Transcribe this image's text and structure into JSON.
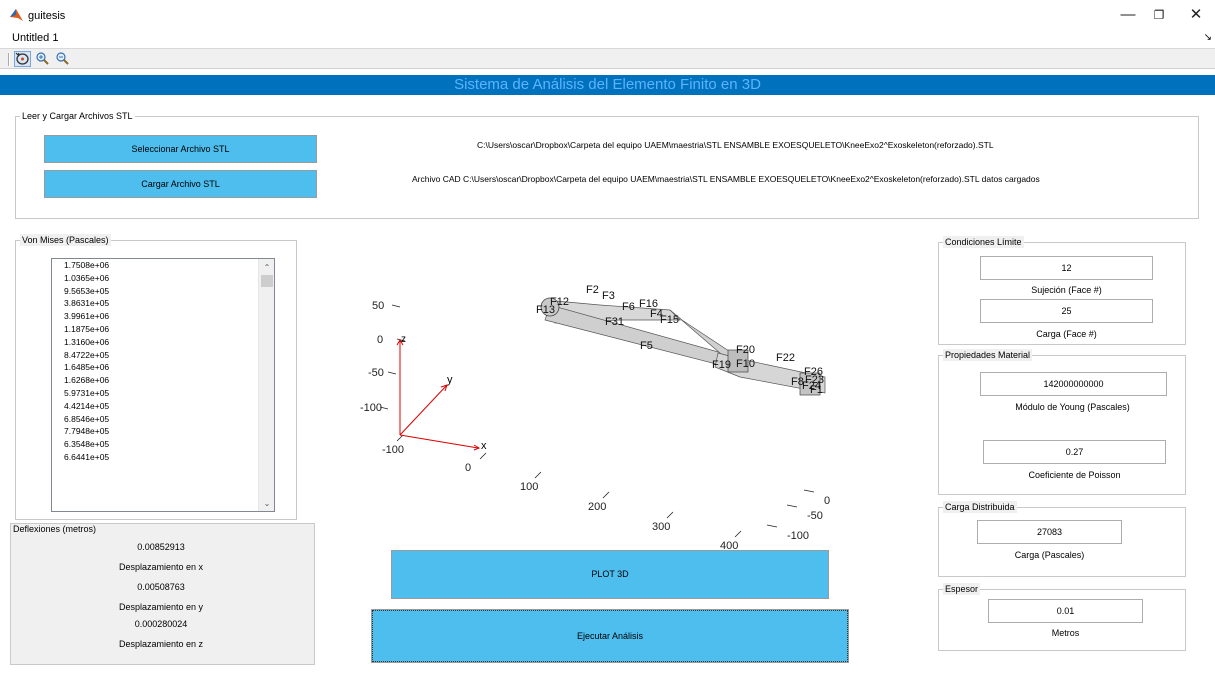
{
  "window": {
    "title": "guitesis",
    "minimize": "—",
    "maximize": "❐",
    "close": "✕"
  },
  "menu": {
    "item": "Untitled 1",
    "arrow": "↘"
  },
  "toolbar": {
    "items": [
      "rotate-3d-icon",
      "zoom-in-icon",
      "zoom-out-icon"
    ]
  },
  "banner": {
    "title": "Sistema de Análisis del Elemento Finito en 3D"
  },
  "stl": {
    "panel_title": "Leer y Cargar Archivos STL",
    "select_label": "Seleccionar Archivo STL",
    "load_label": "Cargar Archivo STL",
    "path": "C:\\Users\\oscar\\Dropbox\\Carpeta del equipo UAEM\\maestria\\STL ENSAMBLE EXOESQUELETO\\KneeExo2^Exoskeleton(reforzado).STL",
    "status": "Archivo CAD C:\\Users\\oscar\\Dropbox\\Carpeta del equipo UAEM\\maestria\\STL ENSAMBLE EXOESQUELETO\\KneeExo2^Exoskeleton(reforzado).STL datos cargados"
  },
  "von_mises": {
    "title": "Von Mises (Pascales)",
    "values": [
      "1.7508e+06",
      "1.0365e+06",
      "9.5653e+05",
      "3.8631e+05",
      "3.9961e+06",
      "1.1875e+06",
      "1.3160e+06",
      "8.4722e+05",
      "1.6485e+06",
      "1.6268e+06",
      "5.9731e+05",
      "4.4214e+05",
      "6.8546e+05",
      "7.7948e+05",
      "6.3548e+05",
      "6.6441e+05"
    ]
  },
  "deflexiones": {
    "title": "Deflexiones (metros)",
    "x_value": "0.00852913",
    "x_label": "Desplazamiento en x",
    "y_value": "0.00508763",
    "y_label": "Desplazamiento en y",
    "z_value": "0.000280024",
    "z_label": "Desplazamiento en z"
  },
  "buttons": {
    "plot": "PLOT 3D",
    "run": "Ejecutar Análisis"
  },
  "condiciones": {
    "title": "Condiciones Límite",
    "sujecion_value": "12",
    "sujecion_label": "Sujeción (Face #)",
    "carga_value": "25",
    "carga_label": "Carga (Face #)"
  },
  "material": {
    "title": "Propiedades Material",
    "young_value": "142000000000",
    "young_label": "Módulo de Young (Pascales)",
    "poisson_value": "0.27",
    "poisson_label": "Coeficiente de Poisson"
  },
  "distribuida": {
    "title": "Carga Distribuida",
    "value": "27083",
    "label": "Carga (Pascales)"
  },
  "espesor": {
    "title": "Espesor",
    "value": "0.01",
    "label": "Metros"
  },
  "plot": {
    "x_ticks": [
      "-100",
      "0",
      "100",
      "200",
      "300",
      "400"
    ],
    "y_ticks": [
      "0",
      "-50",
      "-100"
    ],
    "z_ticks": [
      "50",
      "0",
      "-50",
      "-100"
    ],
    "axis_x": "x",
    "axis_y": "y",
    "axis_z": "z",
    "face_labels": [
      "F2",
      "F12",
      "F13",
      "F3",
      "F16",
      "F6",
      "F4",
      "F15",
      "F31",
      "F5",
      "F20",
      "F22",
      "F19",
      "F10",
      "F26",
      "F8",
      "F23",
      "F24",
      "F1"
    ]
  }
}
